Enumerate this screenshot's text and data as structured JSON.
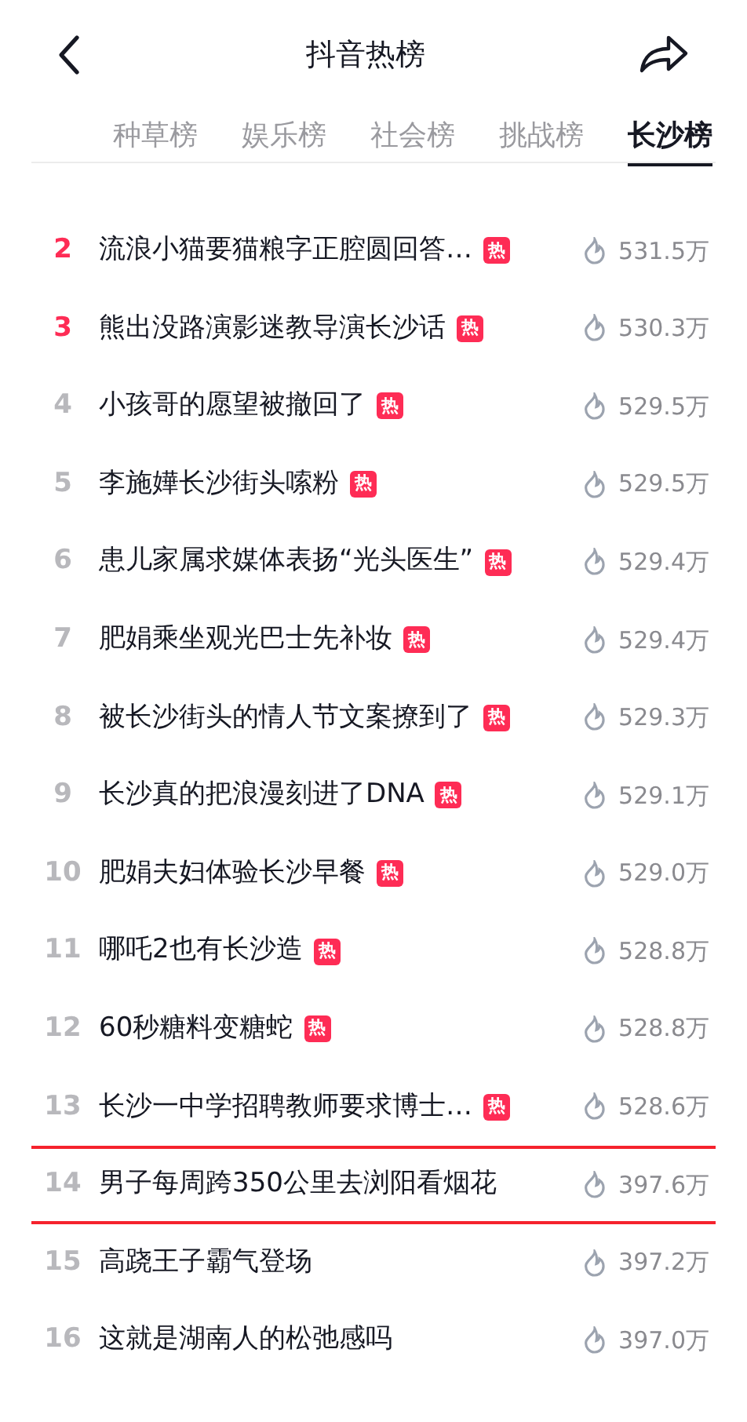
{
  "header": {
    "title": "抖音热榜"
  },
  "tabs": [
    {
      "label": "种草榜",
      "selected": false
    },
    {
      "label": "娱乐榜",
      "selected": false
    },
    {
      "label": "社会榜",
      "selected": false
    },
    {
      "label": "挑战榜",
      "selected": false
    },
    {
      "label": "长沙榜",
      "selected": true
    }
  ],
  "items": [
    {
      "rank": "2",
      "top": true,
      "title": "流浪小猫要猫粮字正腔圆回答…",
      "hot": true,
      "badge": "热",
      "heat": "531.5万",
      "boxed": false
    },
    {
      "rank": "3",
      "top": true,
      "title": "熊出没路演影迷教导演长沙话",
      "hot": true,
      "badge": "热",
      "heat": "530.3万",
      "boxed": false
    },
    {
      "rank": "4",
      "top": false,
      "title": "小孩哥的愿望被撤回了",
      "hot": true,
      "badge": "热",
      "heat": "529.5万",
      "boxed": false
    },
    {
      "rank": "5",
      "top": false,
      "title": "李施嬅长沙街头嗦粉",
      "hot": true,
      "badge": "热",
      "heat": "529.5万",
      "boxed": false
    },
    {
      "rank": "6",
      "top": false,
      "title": "患儿家属求媒体表扬“光头医生”",
      "hot": true,
      "badge": "热",
      "heat": "529.4万",
      "boxed": false
    },
    {
      "rank": "7",
      "top": false,
      "title": "肥娟乘坐观光巴士先补妆",
      "hot": true,
      "badge": "热",
      "heat": "529.4万",
      "boxed": false
    },
    {
      "rank": "8",
      "top": false,
      "title": "被长沙街头的情人节文案撩到了",
      "hot": true,
      "badge": "热",
      "heat": "529.3万",
      "boxed": false
    },
    {
      "rank": "9",
      "top": false,
      "title": "长沙真的把浪漫刻进了DNA",
      "hot": true,
      "badge": "热",
      "heat": "529.1万",
      "boxed": false
    },
    {
      "rank": "10",
      "top": false,
      "title": "肥娟夫妇体验长沙早餐",
      "hot": true,
      "badge": "热",
      "heat": "529.0万",
      "boxed": false
    },
    {
      "rank": "11",
      "top": false,
      "title": "哪吒2也有长沙造",
      "hot": true,
      "badge": "热",
      "heat": "528.8万",
      "boxed": false
    },
    {
      "rank": "12",
      "top": false,
      "title": "60秒糖料变糖蛇",
      "hot": true,
      "badge": "热",
      "heat": "528.8万",
      "boxed": false
    },
    {
      "rank": "13",
      "top": false,
      "title": "长沙一中学招聘教师要求博士…",
      "hot": true,
      "badge": "热",
      "heat": "528.6万",
      "boxed": false
    },
    {
      "rank": "14",
      "top": false,
      "title": "男子每周跨350公里去浏阳看烟花",
      "hot": false,
      "heat": "397.6万",
      "boxed": true
    },
    {
      "rank": "15",
      "top": false,
      "title": "高跷王子霸气登场",
      "hot": false,
      "heat": "397.2万",
      "boxed": false
    },
    {
      "rank": "16",
      "top": false,
      "title": "这就是湖南人的松弛感吗",
      "hot": false,
      "heat": "397.0万",
      "boxed": false
    }
  ]
}
